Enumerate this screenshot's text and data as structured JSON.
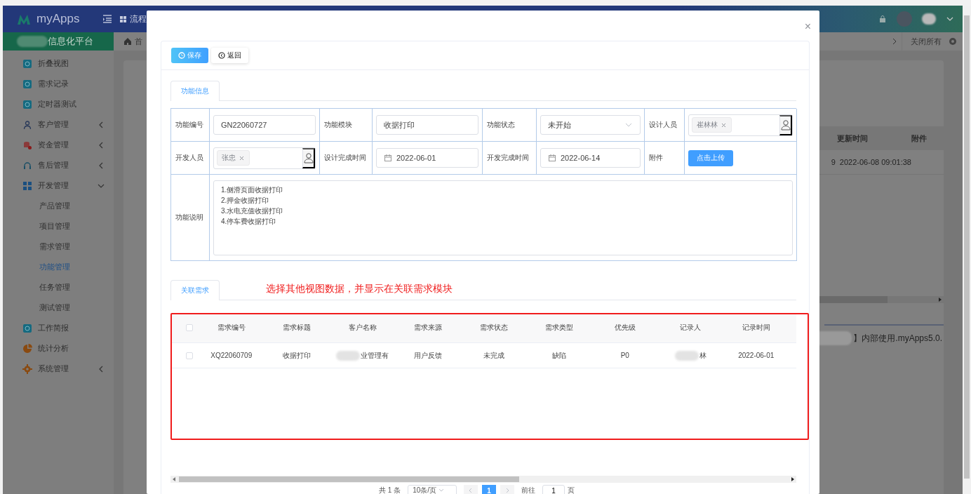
{
  "topbar": {
    "app_name": "myApps",
    "menu_item": "流程",
    "platform": "信息化平台"
  },
  "sidebar": {
    "items": [
      {
        "label": "折叠视图",
        "kind": "link"
      },
      {
        "label": "需求记录",
        "kind": "link"
      },
      {
        "label": "定时器测试",
        "kind": "link"
      },
      {
        "label": "客户管理",
        "kind": "group",
        "expanded": false
      },
      {
        "label": "资金管理",
        "kind": "group",
        "expanded": false
      },
      {
        "label": "售后管理",
        "kind": "group",
        "expanded": false
      },
      {
        "label": "开发管理",
        "kind": "group",
        "expanded": true,
        "children": [
          {
            "label": "产品管理",
            "selected": false
          },
          {
            "label": "项目管理",
            "selected": false
          },
          {
            "label": "需求管理",
            "selected": false
          },
          {
            "label": "功能管理",
            "selected": true
          },
          {
            "label": "任务管理",
            "selected": false
          },
          {
            "label": "测试管理",
            "selected": false
          }
        ]
      },
      {
        "label": "工作简报",
        "kind": "link"
      },
      {
        "label": "统计分析",
        "kind": "link"
      },
      {
        "label": "系统管理",
        "kind": "group",
        "expanded": false
      }
    ]
  },
  "breadcrumb": {
    "home": "首",
    "close_all": "关闭所有"
  },
  "background_table": {
    "columns": [
      "更新时间",
      "附件"
    ],
    "row": {
      "column_1": "9",
      "updated": "2022-06-08 09:01:38"
    }
  },
  "footer_text": "】内部使用.myApps5.0.",
  "dialog": {
    "close": "×",
    "buttons": [
      {
        "label": "保存",
        "kind": "primary"
      },
      {
        "label": "返回",
        "kind": "default"
      }
    ],
    "form_tab": {
      "label": "功能信息",
      "selected": true
    },
    "fields": [
      {
        "label": "功能编号",
        "kind": "text",
        "value": "GN22060727"
      },
      {
        "label": "功能模块",
        "kind": "text",
        "value": "收据打印"
      },
      {
        "label": "功能状态",
        "kind": "select",
        "value": "未开始"
      },
      {
        "label": "设计人员",
        "kind": "people",
        "tags": [
          "崔林林"
        ]
      },
      {
        "label": "开发人员",
        "kind": "people",
        "tags": [
          "张忠"
        ]
      },
      {
        "label": "设计完成时间",
        "kind": "date",
        "value": "2022-06-01"
      },
      {
        "label": "开发完成时间",
        "kind": "date",
        "value": "2022-06-14"
      },
      {
        "label": "附件",
        "kind": "upload",
        "button": "点击上传"
      },
      {
        "label": "功能说明",
        "kind": "textarea",
        "lines": [
          "1.侧滑页面收据打印",
          "2.押金收据打印",
          "3.水电充值收据打印",
          "4.停车费收据打印"
        ]
      }
    ],
    "related_tab": {
      "label": "关联需求",
      "selected": true
    },
    "note": "选择其他视图数据，并显示在关联需求模块",
    "table": {
      "header_checked": false,
      "columns": [
        "需求编号",
        "需求标题",
        "客户名称",
        "需求来源",
        "需求状态",
        "需求类型",
        "优先级",
        "记录人",
        "记录时间"
      ],
      "rows": [
        {
          "checked": false,
          "cells": [
            {
              "text": "XQ22060709",
              "blurred": false
            },
            {
              "text": "收据打印",
              "blurred": false
            },
            {
              "text": "业管理有",
              "blurred": true
            },
            {
              "text": "用户反馈",
              "blurred": false
            },
            {
              "text": "未完成",
              "blurred": false
            },
            {
              "text": "缺陷",
              "blurred": false
            },
            {
              "text": "P0",
              "blurred": false
            },
            {
              "text": "林",
              "blurred": true
            },
            {
              "text": "2022-06-01",
              "blurred": false
            }
          ]
        }
      ]
    },
    "pagination": {
      "total": "共 1 条",
      "page_size": "10条/页",
      "pages": [
        {
          "label": "1",
          "selected": true
        }
      ],
      "goto_label": "前往",
      "goto_value": "1",
      "page_suffix": "页"
    }
  }
}
